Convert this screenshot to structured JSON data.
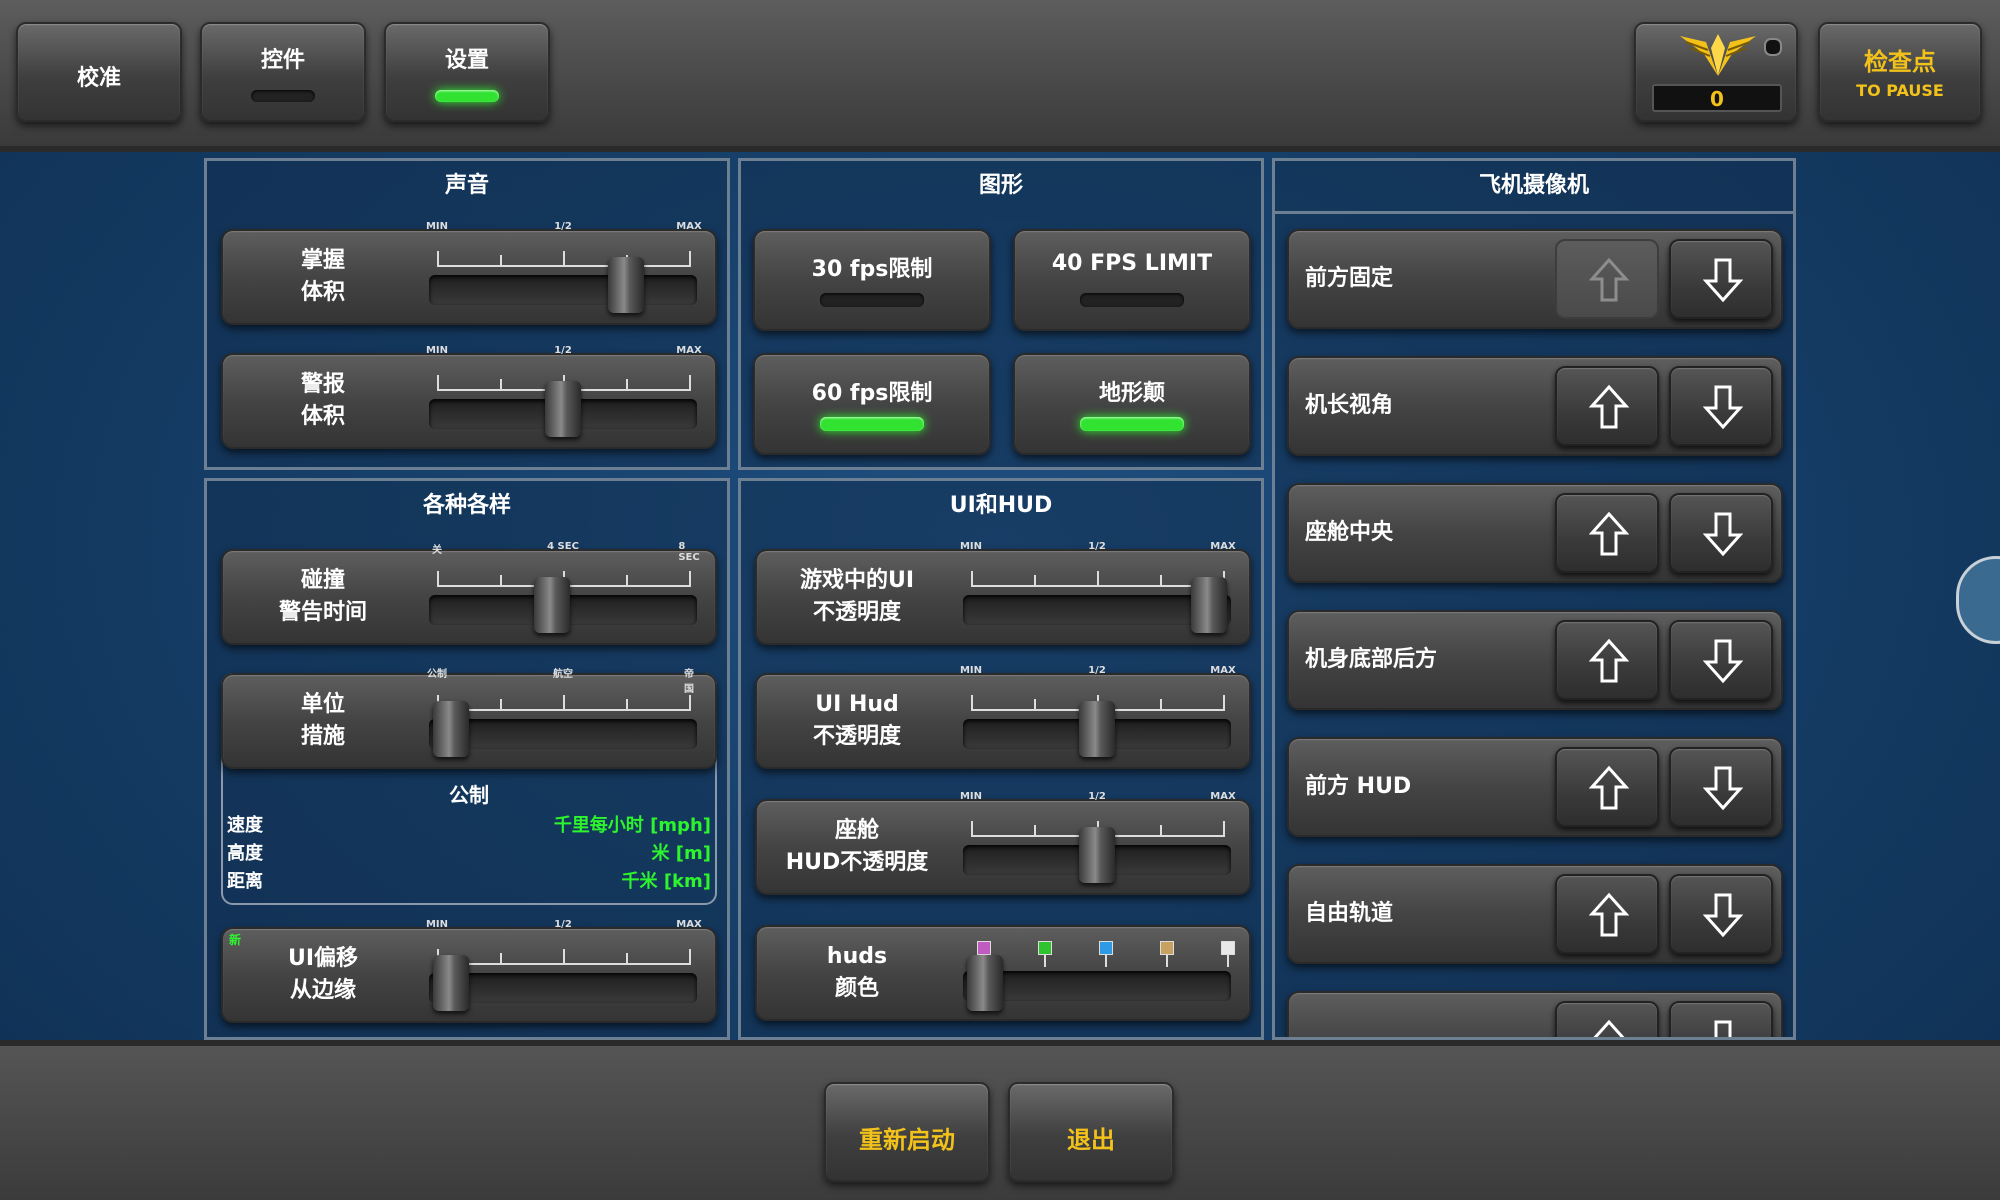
{
  "topbar": {
    "tabs": [
      {
        "label": "校准"
      },
      {
        "label": "控件"
      },
      {
        "label": "设置"
      }
    ],
    "score": "0",
    "checkpoint": {
      "title": "检查点",
      "sub": "TO PAUSE"
    }
  },
  "sound": {
    "title": "声音",
    "rows": [
      {
        "label1": "掌握",
        "label2": "体积",
        "ticks": [
          "MIN",
          "1/2",
          "MAX"
        ],
        "value": 0.78
      },
      {
        "label1": "警报",
        "label2": "体积",
        "ticks": [
          "MIN",
          "1/2",
          "MAX"
        ],
        "value": 0.5
      }
    ]
  },
  "graphics": {
    "title": "图形",
    "toggles": [
      {
        "label": "30 fps限制",
        "on": false
      },
      {
        "label": "40 FPS LIMIT",
        "on": false
      },
      {
        "label": "60 fps限制",
        "on": true
      },
      {
        "label": "地形颠",
        "on": true
      }
    ]
  },
  "misc": {
    "title": "各种各样",
    "collision": {
      "label1": "碰撞",
      "label2": "警告时间",
      "ticks": [
        "关",
        "4 SEC",
        "8 SEC"
      ],
      "value": 0.45
    },
    "units": {
      "label1": "单位",
      "label2": "措施",
      "ticks": [
        "公制",
        "航空",
        "帝国"
      ],
      "value": 0.0
    },
    "unit_system": "公制",
    "unit_rows": [
      {
        "name": "速度",
        "value": "千里每小时 [mph]"
      },
      {
        "name": "高度",
        "value": "米 [m]"
      },
      {
        "name": "距离",
        "value": "千米 [km]"
      }
    ],
    "offset": {
      "badge": "新",
      "label1": "UI偏移",
      "label2": "从边缘",
      "ticks": [
        "MIN",
        "1/2",
        "MAX"
      ],
      "value": 0.0
    }
  },
  "uihud": {
    "title": "UI和HUD",
    "rows": [
      {
        "label1": "游戏中的UI",
        "label2": "不透明度",
        "ticks": [
          "MIN",
          "1/2",
          "MAX"
        ],
        "value": 1.0
      },
      {
        "label1": "UI Hud",
        "label2": "不透明度",
        "ticks": [
          "MIN",
          "1/2",
          "MAX"
        ],
        "value": 0.5
      },
      {
        "label1": "座舱",
        "label2": "HUD不透明度",
        "ticks": [
          "MIN",
          "1/2",
          "MAX"
        ],
        "value": 0.5
      }
    ],
    "hud_color": {
      "label1": "huds",
      "label2": "颜色",
      "swatches": [
        "#c05cc0",
        "#2ec42e",
        "#2e9ae6",
        "#c8a060",
        "#e8e8e8"
      ],
      "value": 0.0
    }
  },
  "camera": {
    "title": "飞机摄像机",
    "rows": [
      {
        "label": "前方固定",
        "up_enabled": false
      },
      {
        "label": "机长视角",
        "up_enabled": true
      },
      {
        "label": "座舱中央",
        "up_enabled": true
      },
      {
        "label": "机身底部后方",
        "up_enabled": true
      },
      {
        "label": "前方 HUD",
        "up_enabled": true
      },
      {
        "label": "自由轨道",
        "up_enabled": true
      }
    ]
  },
  "bottom": {
    "restart": "重新启动",
    "exit": "退出"
  },
  "colors": {
    "accent_green": "#2df52d",
    "gold": "#f2c21b"
  }
}
